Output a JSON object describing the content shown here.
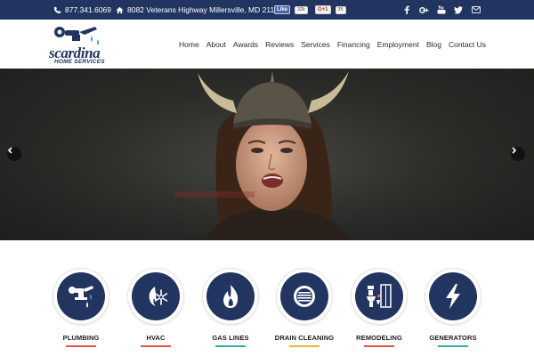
{
  "topbar": {
    "phone": "877.341.6069",
    "address": "8082 Veterans Highway Millersville, MD 21108",
    "fb_like": "Like",
    "fb_count": "32k",
    "gplus": "G+1",
    "gplus_count": "35",
    "social_icons": [
      "facebook-icon",
      "google-plus-icon",
      "youtube-icon",
      "twitter-icon",
      "email-icon"
    ]
  },
  "logo": {
    "name": "scardina",
    "tagline": "HOME SERVICES"
  },
  "nav": [
    "Home",
    "About",
    "Awards",
    "Reviews",
    "Services",
    "Financing",
    "Employment",
    "Blog",
    "Contact Us"
  ],
  "hero": {
    "prev_icon": "chevron-left-icon",
    "next_icon": "chevron-right-icon"
  },
  "services": [
    {
      "label": "PLUMBING",
      "icon": "faucet-icon",
      "accent": "#e5534b"
    },
    {
      "label": "HVAC",
      "icon": "fire-snowflake-icon",
      "accent": "#e5534b"
    },
    {
      "label": "GAS LINES",
      "icon": "flame-icon",
      "accent": "#2bb3a0"
    },
    {
      "label": "DRAIN CLEANING",
      "icon": "drain-icon",
      "accent": "#e5b93b"
    },
    {
      "label": "REMODELING",
      "icon": "bathroom-icon",
      "accent": "#e5534b"
    },
    {
      "label": "GENERATORS",
      "icon": "lightning-icon",
      "accent": "#2bb3a0"
    }
  ],
  "colors": {
    "brand_navy": "#223460",
    "topbar": "#223460"
  }
}
